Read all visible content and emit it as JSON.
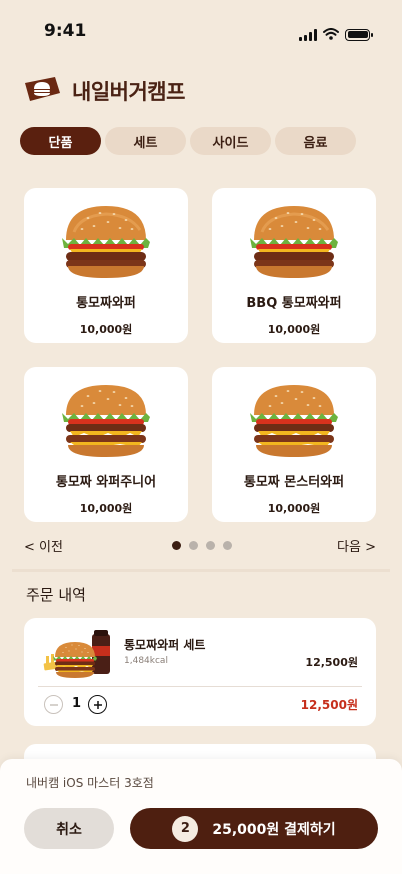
{
  "status_bar": {
    "time": "9:41",
    "icons": [
      "signal-icon",
      "wifi-icon",
      "battery-icon"
    ]
  },
  "header": {
    "logo_icon": "burger-logo-icon",
    "title": "내일버거캠프"
  },
  "tabs": [
    {
      "label": "단품",
      "active": true
    },
    {
      "label": "세트",
      "active": false
    },
    {
      "label": "사이드",
      "active": false
    },
    {
      "label": "음료",
      "active": false
    }
  ],
  "menu_items": [
    {
      "name": "통모짜와퍼",
      "price": "10,000원",
      "image": "burger-icon"
    },
    {
      "name": "BBQ 통모짜와퍼",
      "price": "10,000원",
      "image": "burger-icon"
    },
    {
      "name": "통모짜 와퍼주니어",
      "price": "10,000원",
      "image": "double-burger-icon"
    },
    {
      "name": "통모짜 몬스터와퍼",
      "price": "10,000원",
      "image": "double-burger-icon"
    }
  ],
  "pager": {
    "prev": "< 이전",
    "next": "다음 >",
    "page_count": 4,
    "current_page": 1
  },
  "order": {
    "title": "주문 내역",
    "items": [
      {
        "name": "통모짜와퍼 세트",
        "kcal": "1,484kcal",
        "unit_price": "12,500원",
        "quantity": "1",
        "total_price": "12,500원",
        "image": "burger-set-icon"
      }
    ]
  },
  "footer": {
    "kiosk_name": "내버캠 iOS 마스터 3호점",
    "cancel_label": "취소",
    "pay_count": "2",
    "pay_label": "25,000원 결제하기"
  },
  "colors": {
    "background": "#f3e9dc",
    "brand_dark": "#5a200f",
    "accent_red": "#c62f1c",
    "tab_inactive": "#ead9c8"
  }
}
